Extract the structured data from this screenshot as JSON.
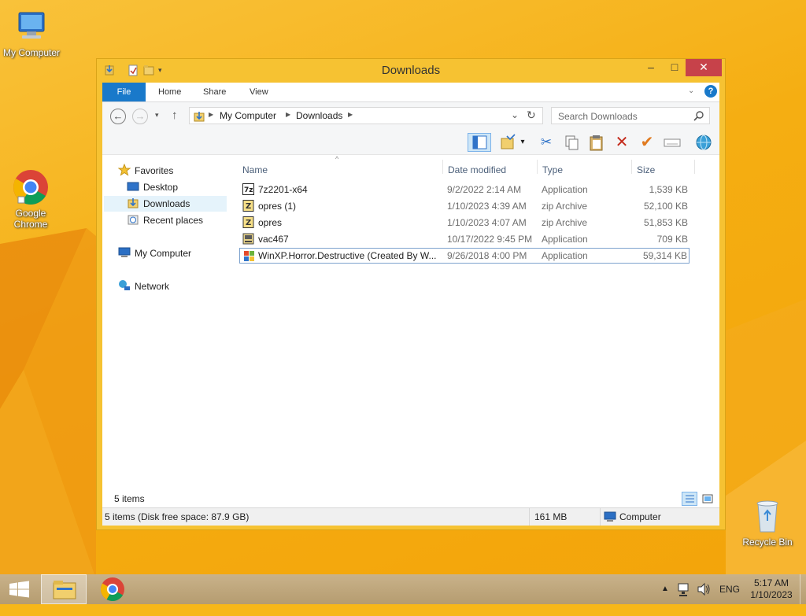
{
  "desktop": {
    "icons": [
      {
        "label": "My Computer",
        "icon": "computer-icon"
      },
      {
        "label": "Google Chrome",
        "icon": "chrome-icon"
      },
      {
        "label": "Recycle Bin",
        "icon": "recycle-bin-icon"
      }
    ]
  },
  "window": {
    "title": "Downloads",
    "buttons": {
      "minimize": "–",
      "maximize": "□",
      "close": "✕"
    }
  },
  "ribbon": {
    "tabs": [
      "File",
      "Home",
      "Share",
      "View"
    ]
  },
  "address": {
    "crumbs": [
      "My Computer",
      "Downloads"
    ],
    "search_placeholder": "Search Downloads"
  },
  "navpane": {
    "favorites": "Favorites",
    "desktop": "Desktop",
    "downloads": "Downloads",
    "recent": "Recent places",
    "computer": "My Computer",
    "network": "Network"
  },
  "columns": {
    "name": "Name",
    "date": "Date modified",
    "type": "Type",
    "size": "Size"
  },
  "files": [
    {
      "name": "7z2201-x64",
      "date": "9/2/2022 2:14 AM",
      "type": "Application",
      "size": "1,539 KB",
      "icon": "7zip-icon"
    },
    {
      "name": "opres (1)",
      "date": "1/10/2023 4:39 AM",
      "type": "zip Archive",
      "size": "52,100 KB",
      "icon": "zip-archive-icon"
    },
    {
      "name": "opres",
      "date": "1/10/2023 4:07 AM",
      "type": "zip Archive",
      "size": "51,853 KB",
      "icon": "zip-archive-icon"
    },
    {
      "name": "vac467",
      "date": "10/17/2022 9:45 PM",
      "type": "Application",
      "size": "709 KB",
      "icon": "application-icon"
    },
    {
      "name": "WinXP.Horror.Destructive  (Created By W...",
      "date": "9/26/2018 4:00 PM",
      "type": "Application",
      "size": "59,314 KB",
      "icon": "windows-flag-icon"
    }
  ],
  "item_count": "5 items",
  "status": {
    "left": "5 items (Disk free space: 87.9 GB)",
    "size": "161 MB",
    "location": "Computer"
  },
  "taskbar": {
    "language": "ENG",
    "time": "5:17 AM",
    "date": "1/10/2023"
  }
}
